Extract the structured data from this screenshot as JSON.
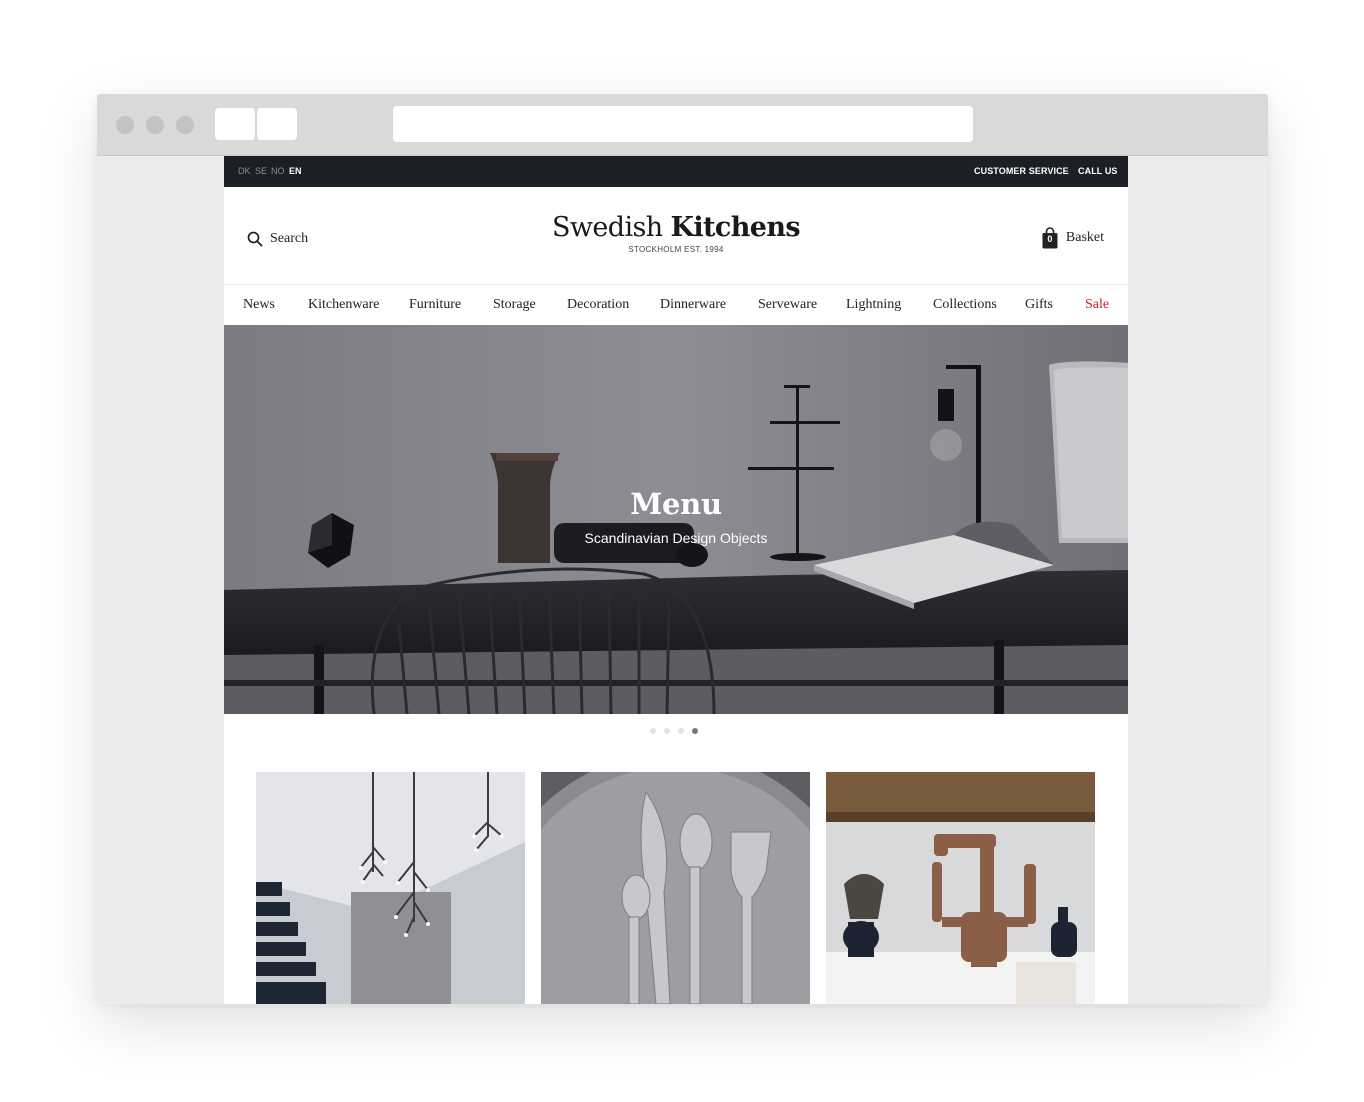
{
  "topbar": {
    "languages": [
      {
        "code": "DK",
        "active": false
      },
      {
        "code": "SE",
        "active": false
      },
      {
        "code": "NO",
        "active": false
      },
      {
        "code": "EN",
        "active": true
      }
    ],
    "customer_service": "CUSTOMER SERVICE",
    "call_us": "CALL US"
  },
  "header": {
    "search_label": "Search",
    "logo_regular": "Swedish",
    "logo_bold": "Kitchens",
    "logo_sub": "STOCKHOLM EST. 1994",
    "basket_label": "Basket",
    "basket_count": "0"
  },
  "nav": {
    "items": [
      {
        "label": "News"
      },
      {
        "label": "Kitchenware"
      },
      {
        "label": "Furniture"
      },
      {
        "label": "Storage"
      },
      {
        "label": "Decoration"
      },
      {
        "label": "Dinnerware"
      },
      {
        "label": "Serveware"
      },
      {
        "label": "Lightning"
      },
      {
        "label": "Collections"
      },
      {
        "label": "Gifts"
      },
      {
        "label": "Sale"
      }
    ]
  },
  "hero": {
    "title": "Menu",
    "subtitle": "Scandinavian Design Objects",
    "slides": 4,
    "active_slide": 4
  },
  "colors": {
    "topbar_bg": "#1d1f26",
    "sale": "#d0202a"
  },
  "icons": [
    "search-icon",
    "basket-icon"
  ]
}
